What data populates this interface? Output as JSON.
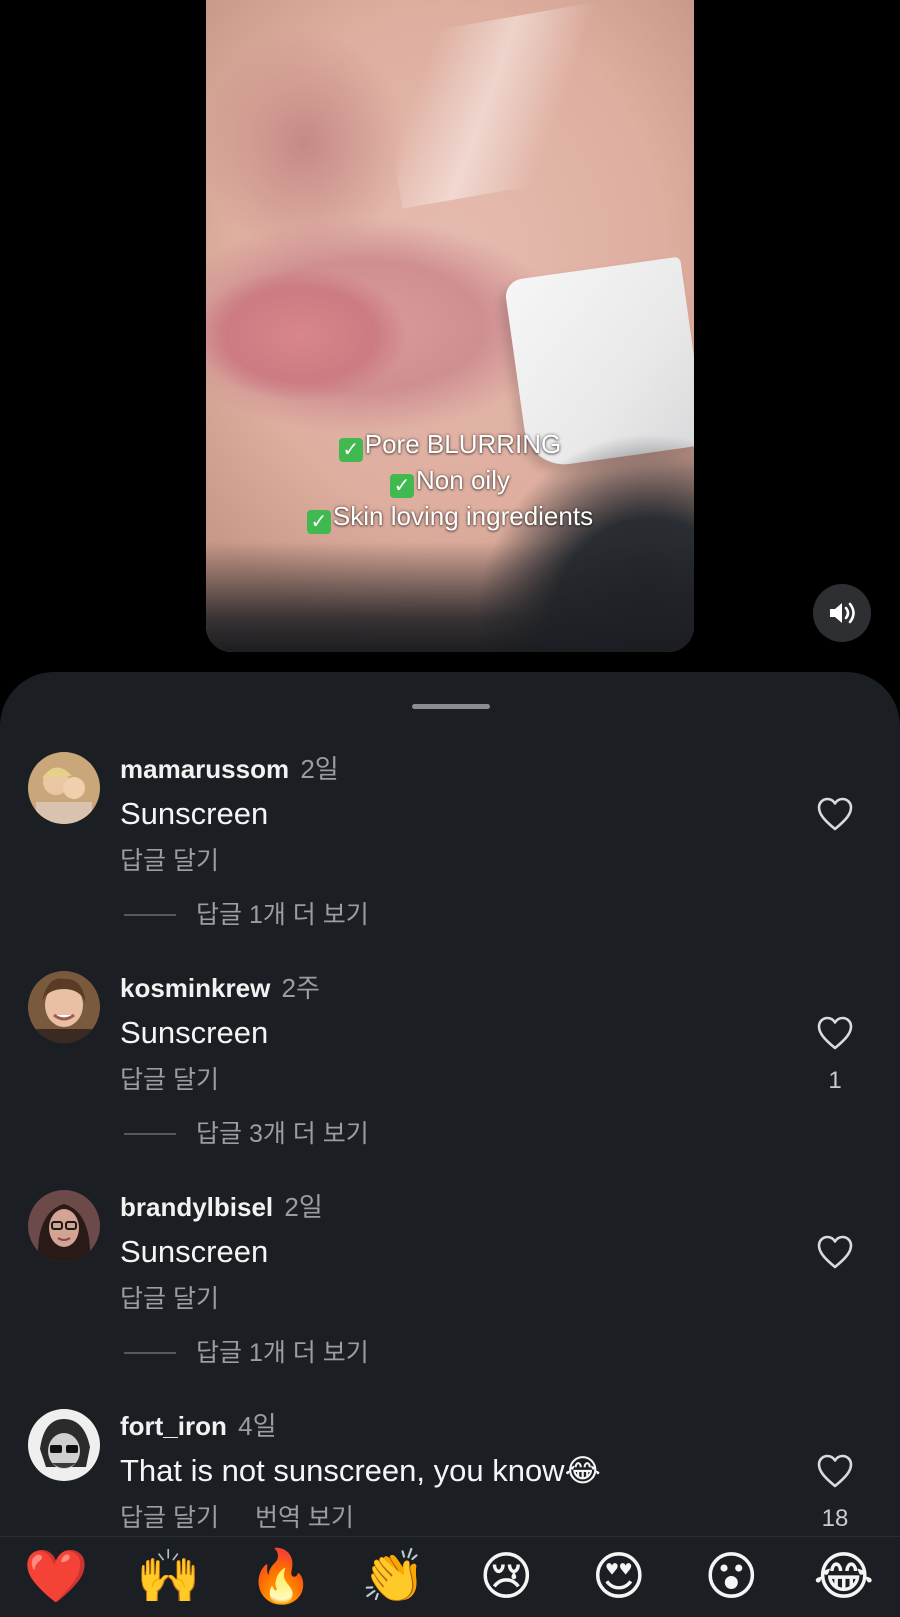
{
  "video": {
    "caption_lines": [
      "Pore BLURRING",
      "Non oily",
      "Skin loving ingredients"
    ],
    "check_glyph": "✓",
    "sound_icon": "speaker-on-icon"
  },
  "comments": [
    {
      "username": "mamarussom",
      "time": "2일",
      "text": "Sunscreen",
      "reply_label": "답글 달기",
      "translate_label": "",
      "more_replies": "답글 1개 더 보기",
      "likes": ""
    },
    {
      "username": "kosminkrew",
      "time": "2주",
      "text": "Sunscreen",
      "reply_label": "답글 달기",
      "translate_label": "",
      "more_replies": "답글 3개 더 보기",
      "likes": "1"
    },
    {
      "username": "brandylbisel",
      "time": "2일",
      "text": "Sunscreen",
      "reply_label": "답글 달기",
      "translate_label": "",
      "more_replies": "답글 1개 더 보기",
      "likes": ""
    },
    {
      "username": "fort_iron",
      "time": "4일",
      "text": "That is not sunscreen,  you know😂",
      "reply_label": "답글 달기",
      "translate_label": "번역 보기",
      "more_replies": "",
      "likes": "18"
    }
  ],
  "emoji_bar": [
    "❤️",
    "🙌",
    "🔥",
    "👏",
    "😢",
    "😍",
    "😮",
    "😂"
  ],
  "colors": {
    "sheet_background": "#1b1e22",
    "secondary_text": "#9a9da2",
    "caption_check": "#3fb950"
  }
}
